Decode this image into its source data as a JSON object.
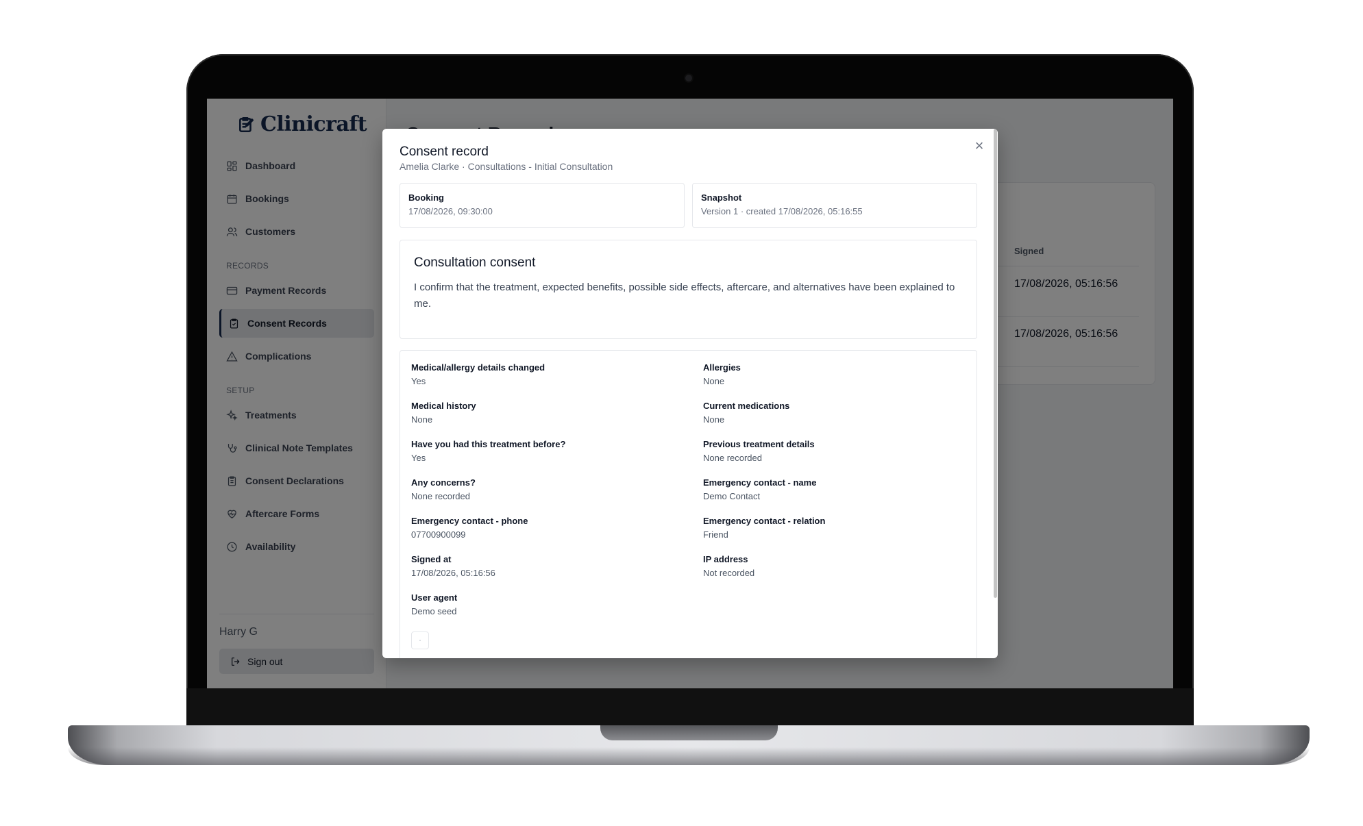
{
  "app": {
    "brand": "Clinicraft",
    "page_title": "Consent Records"
  },
  "sidebar": {
    "items": [
      {
        "label": "Dashboard",
        "icon": "dashboard-icon"
      },
      {
        "label": "Bookings",
        "icon": "calendar-icon"
      },
      {
        "label": "Customers",
        "icon": "users-icon"
      },
      {
        "label": "Payment Records",
        "icon": "card-icon"
      },
      {
        "label": "Consent Records",
        "icon": "clipboard-check-icon",
        "active": true
      },
      {
        "label": "Complications",
        "icon": "alert-triangle-icon"
      },
      {
        "label": "Treatments",
        "icon": "sparkles-icon"
      },
      {
        "label": "Clinical Note Templates",
        "icon": "stethoscope-icon"
      },
      {
        "label": "Consent Declarations",
        "icon": "clipboard-list-icon"
      },
      {
        "label": "Aftercare Forms",
        "icon": "heart-pulse-icon"
      },
      {
        "label": "Availability",
        "icon": "clock-icon"
      }
    ],
    "sections": {
      "records": "RECORDS",
      "setup": "SETUP"
    },
    "user_name": "Harry G",
    "signout_label": "Sign out"
  },
  "background_table": {
    "signed_header": "Signed",
    "rows": [
      {
        "signed": "17/08/2026, 05:16:56"
      },
      {
        "signed": "17/08/2026, 05:16:56"
      }
    ]
  },
  "modal": {
    "title": "Consent record",
    "subtitle": "Amelia Clarke · Consultations - Initial Consultation",
    "close_label": "×",
    "booking": {
      "label": "Booking",
      "value": "17/08/2026, 09:30:00"
    },
    "snapshot": {
      "label": "Snapshot",
      "value": "Version 1 · created 17/08/2026, 05:16:55"
    },
    "consent": {
      "title": "Consultation consent",
      "text": "I confirm that the treatment, expected benefits, possible side effects, aftercare, and alternatives have been explained to me."
    },
    "answers": [
      {
        "label": "Medical/allergy details changed",
        "value": "Yes"
      },
      {
        "label": "Allergies",
        "value": "None"
      },
      {
        "label": "Medical history",
        "value": "None"
      },
      {
        "label": "Current medications",
        "value": "None"
      },
      {
        "label": "Have you had this treatment before?",
        "value": "Yes"
      },
      {
        "label": "Previous treatment details",
        "value": "None recorded"
      },
      {
        "label": "Any concerns?",
        "value": "None recorded"
      },
      {
        "label": "Emergency contact - name",
        "value": "Demo Contact"
      },
      {
        "label": "Emergency contact - phone",
        "value": "07700900099"
      },
      {
        "label": "Emergency contact - relation",
        "value": "Friend"
      },
      {
        "label": "Signed at",
        "value": "17/08/2026, 05:16:56"
      },
      {
        "label": "IP address",
        "value": "Not recorded"
      },
      {
        "label": "User agent",
        "value": "Demo seed"
      }
    ]
  }
}
